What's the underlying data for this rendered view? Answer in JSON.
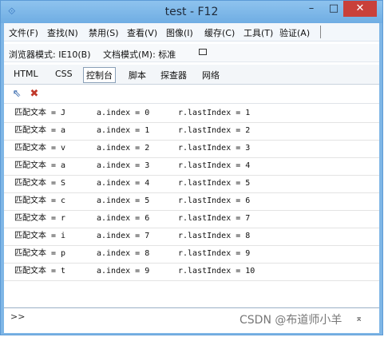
{
  "window": {
    "title": "test - F12",
    "min": "–",
    "max": "□",
    "close": "✕"
  },
  "menu": [
    {
      "label": "文件(F)"
    },
    {
      "label": "查找(N)"
    },
    {
      "label": "禁用(S)"
    },
    {
      "label": "查看(V)"
    },
    {
      "label": "图像(I)"
    },
    {
      "label": "缓存(C)"
    },
    {
      "label": "工具(T)"
    },
    {
      "label": "验证(A)"
    }
  ],
  "modebar": {
    "browser_mode": "浏览器模式: IE10(B)",
    "doc_mode": "文档模式(M): 标准"
  },
  "tabs": [
    {
      "label": "HTML"
    },
    {
      "label": "CSS"
    },
    {
      "label": "控制台",
      "active": true
    },
    {
      "label": "脚本"
    },
    {
      "label": "探查器"
    },
    {
      "label": "网络"
    }
  ],
  "console": {
    "rows": [
      {
        "match": "匹配文本 = J",
        "index": "a.index = 0",
        "last": "r.lastIndex = 1"
      },
      {
        "match": "匹配文本 = a",
        "index": "a.index = 1",
        "last": "r.lastIndex = 2"
      },
      {
        "match": "匹配文本 = v",
        "index": "a.index = 2",
        "last": "r.lastIndex = 3"
      },
      {
        "match": "匹配文本 = a",
        "index": "a.index = 3",
        "last": "r.lastIndex = 4"
      },
      {
        "match": "匹配文本 = S",
        "index": "a.index = 4",
        "last": "r.lastIndex = 5"
      },
      {
        "match": "匹配文本 = c",
        "index": "a.index = 5",
        "last": "r.lastIndex = 6"
      },
      {
        "match": "匹配文本 = r",
        "index": "a.index = 6",
        "last": "r.lastIndex = 7"
      },
      {
        "match": "匹配文本 = i",
        "index": "a.index = 7",
        "last": "r.lastIndex = 8"
      },
      {
        "match": "匹配文本 = p",
        "index": "a.index = 8",
        "last": "r.lastIndex = 9"
      },
      {
        "match": "匹配文本 = t",
        "index": "a.index = 9",
        "last": "r.lastIndex = 10"
      }
    ]
  },
  "cmdline": {
    "prompt": ">>"
  },
  "watermark": "CSDN @布道师小羊"
}
